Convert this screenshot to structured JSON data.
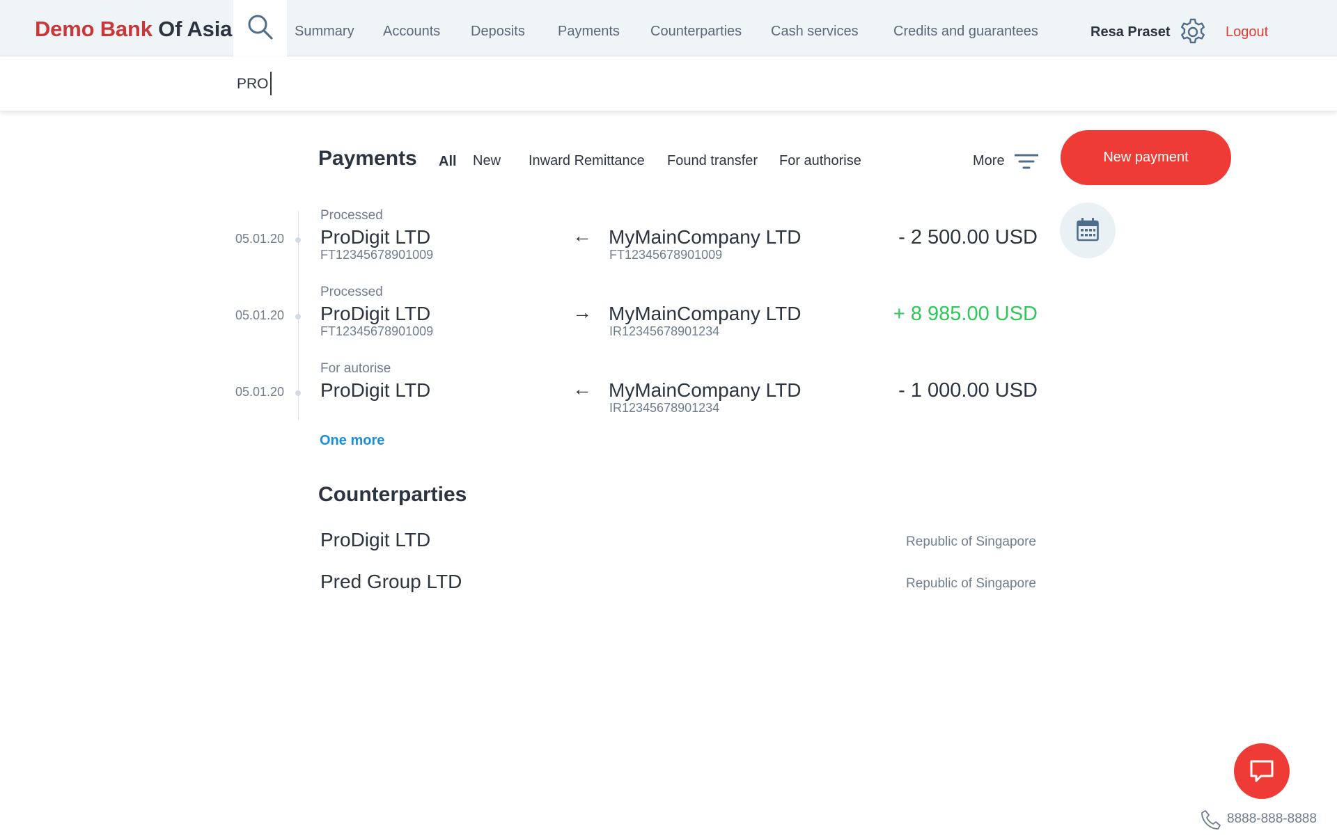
{
  "brand": {
    "part1": "Demo Bank",
    "part2": "Of Asia"
  },
  "nav": {
    "items": [
      {
        "label": "Summary"
      },
      {
        "label": "Accounts"
      },
      {
        "label": "Deposits"
      },
      {
        "label": "Payments"
      },
      {
        "label": "Counterparties"
      },
      {
        "label": "Cash services"
      },
      {
        "label": "Credits and guarantees"
      }
    ],
    "user_name": "Resa Praset",
    "logout_label": "Logout"
  },
  "search": {
    "value": "PRO",
    "icon": "search-icon"
  },
  "payments": {
    "title": "Payments",
    "filters": [
      {
        "label": "All",
        "active": true
      },
      {
        "label": "New",
        "active": false
      },
      {
        "label": "Inward Remittance",
        "active": false
      },
      {
        "label": "Found transfer",
        "active": false
      },
      {
        "label": "For authorise",
        "active": false
      }
    ],
    "more_label": "More",
    "new_payment_label": "New payment",
    "rows": [
      {
        "date": "05.01.20",
        "status": "Processed",
        "from": "ProDigit LTD",
        "from_ref": "FT12345678901009",
        "direction": "←",
        "to": "MyMainCompany LTD",
        "to_ref": "FT12345678901009",
        "amount": "- 2 500.00 USD"
      },
      {
        "date": "05.01.20",
        "status": "Processed",
        "from": "ProDigit LTD",
        "from_ref": "FT12345678901009",
        "direction": "→",
        "to": "MyMainCompany LTD",
        "to_ref": "IR12345678901234",
        "amount": "+ 8 985.00 USD"
      },
      {
        "date": "05.01.20",
        "status": "For autorise",
        "from": "ProDigit LTD",
        "from_ref": "",
        "direction": "←",
        "to": "MyMainCompany LTD",
        "to_ref": "IR12345678901234",
        "amount": "- 1 000.00 USD"
      }
    ],
    "one_more_label": "One more"
  },
  "counterparties": {
    "title": "Counterparties",
    "rows": [
      {
        "name": "ProDigit LTD",
        "country": "Republic of Singapore"
      },
      {
        "name": "Pred Group LTD",
        "country": "Republic of Singapore"
      }
    ]
  },
  "support": {
    "phone": "8888-888-8888"
  },
  "colors": {
    "accent_red": "#ef3b36",
    "positive_green": "#2fc65a",
    "link_blue": "#1b8fd6"
  }
}
